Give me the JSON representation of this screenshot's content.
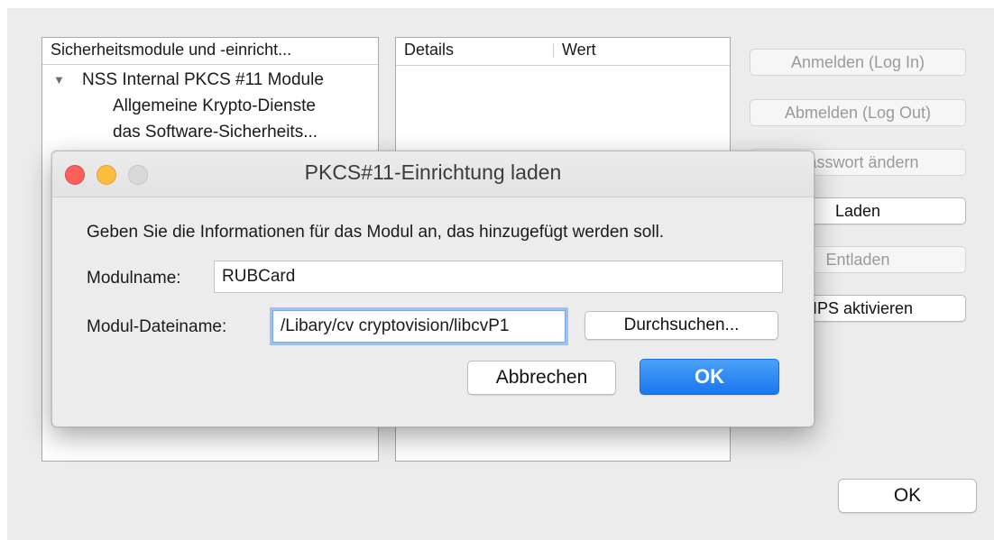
{
  "modules_panel": {
    "header": "Sicherheitsmodule und -einricht...",
    "rows": [
      {
        "label": "NSS Internal PKCS #11 Module"
      },
      {
        "label": "Allgemeine Krypto-Dienste"
      },
      {
        "label": "das Software-Sicherheits..."
      }
    ]
  },
  "details_panel": {
    "col_details": "Details",
    "col_value": "Wert"
  },
  "side_buttons": {
    "login": "Anmelden (Log In)",
    "logout": "Abmelden (Log Out)",
    "change_password": "Passwort ändern",
    "load": "Laden",
    "unload": "Entladen",
    "fips": "FIPS aktivieren"
  },
  "main_ok": "OK",
  "dialog": {
    "title": "PKCS#11-Einrichtung laden",
    "instruction": "Geben Sie die Informationen für das Modul an, das hinzugefügt werden soll.",
    "module_name_label": "Modulname:",
    "module_name_value": "RUBCard",
    "module_file_label": "Modul-Dateiname:",
    "module_file_value": "/Libary/cv cryptovision/libcvP1",
    "browse": "Durchsuchen...",
    "cancel": "Abbrechen",
    "ok": "OK"
  },
  "colors": {
    "accent": "#1877f0",
    "close": "#fc605c",
    "minimize": "#fdbc40"
  }
}
